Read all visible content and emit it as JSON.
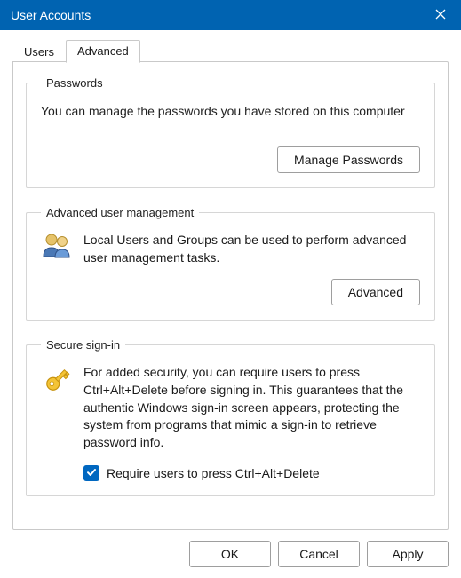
{
  "window": {
    "title": "User Accounts"
  },
  "tabs": {
    "users": "Users",
    "advanced": "Advanced"
  },
  "passwords": {
    "legend": "Passwords",
    "desc": "You can manage the passwords you have stored on this computer",
    "button": "Manage Passwords"
  },
  "advancedGroup": {
    "legend": "Advanced user management",
    "desc": "Local Users and Groups can be used to perform advanced user management tasks.",
    "button": "Advanced"
  },
  "secure": {
    "legend": "Secure sign-in",
    "desc": "For added security, you can require users to press Ctrl+Alt+Delete before signing in. This guarantees that the authentic Windows sign-in screen appears, protecting the system from programs that mimic a sign-in to retrieve password info.",
    "checkboxLabel": "Require users to press Ctrl+Alt+Delete",
    "checked": true
  },
  "buttons": {
    "ok": "OK",
    "cancel": "Cancel",
    "apply": "Apply"
  }
}
